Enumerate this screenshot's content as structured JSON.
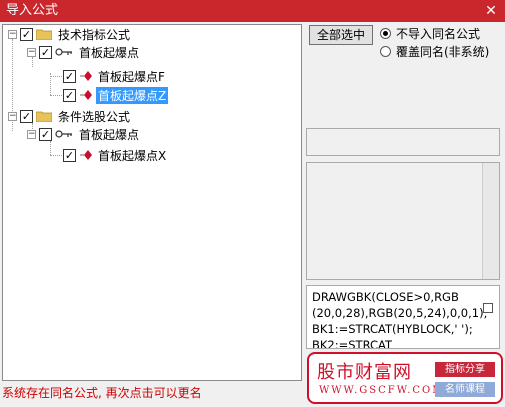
{
  "window": {
    "title": "导入公式",
    "close_glyph": "✕"
  },
  "tree": {
    "check_glyph": "✓",
    "expand_glyph": "−",
    "nodes": [
      {
        "label": "技术指标公式",
        "icon": "folder-icon",
        "checked": true
      },
      {
        "label": "首板起爆点",
        "icon": "key-icon",
        "checked": true
      },
      {
        "label": "首板起爆点F",
        "icon": "gem-icon",
        "checked": true
      },
      {
        "label": "首板起爆点Z",
        "icon": "gem-icon",
        "checked": true,
        "selected": true
      },
      {
        "label": "条件选股公式",
        "icon": "folder-icon",
        "checked": true
      },
      {
        "label": "首板起爆点",
        "icon": "key-icon",
        "checked": true
      },
      {
        "label": "首板起爆点X",
        "icon": "gem-icon",
        "checked": true
      }
    ]
  },
  "controls": {
    "select_all": "全部选中",
    "radio_no_import": "不导入同名公式",
    "radio_overwrite": "覆盖同名(非系统)",
    "selected_radio": "no_import"
  },
  "code_lines": [
    "DRAWGBK(CLOSE>0,RGB",
    "(20,0,28),RGB(20,5,24),0,0,1);",
    "BK1:=STRCAT(HYBLOCK,' ');",
    "BK2:=STRCAT"
  ],
  "status": "系统存在同名公式, 再次点击可以更名",
  "watermark": {
    "brand": "股市财富网",
    "site": "WWW.GSCFW.COM",
    "tag1": "指标分享",
    "tag2": "名师课程"
  },
  "colors": {
    "title_bar": "#c9272c",
    "selection": "#3399ff",
    "status_text": "#d10000",
    "gem": "#c8102e"
  }
}
